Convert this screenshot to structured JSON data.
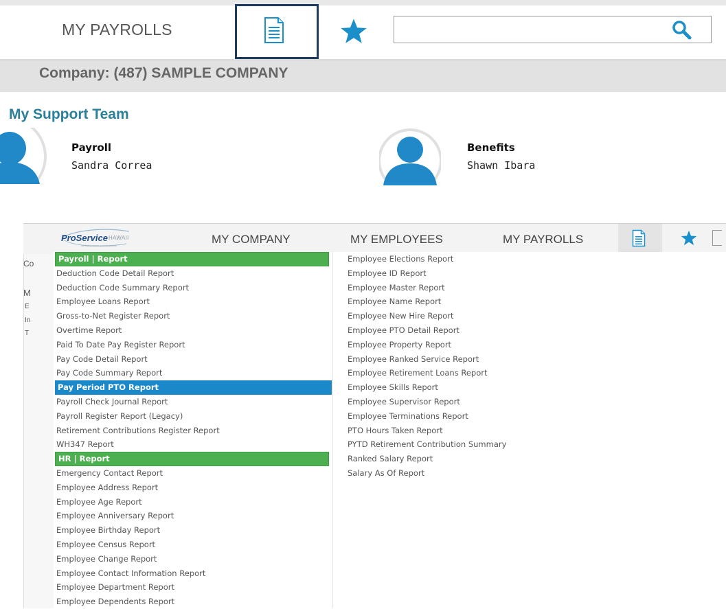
{
  "top": {
    "nav_label": "MY PAYROLLS",
    "search_value": "",
    "company": "Company: (487) SAMPLE COMPANY",
    "support_title": "My Support Team",
    "team": [
      {
        "role": "Payroll",
        "name": "Sandra Correa"
      },
      {
        "role": "Benefits",
        "name": "Shawn Ibara"
      }
    ],
    "icons": {
      "documents": "document-icon",
      "favorites": "star-icon",
      "search": "search-icon"
    },
    "colors": {
      "accent": "#1b8fc9",
      "heading": "#2a7f9a",
      "highlight_border": "#1d3b5f"
    }
  },
  "nav2": {
    "logo_text": "ProService",
    "logo_sub": "HAWAII",
    "logo_tagline": "All that powers your business",
    "items": [
      "MY COMPANY",
      "MY EMPLOYEES",
      "MY PAYROLLS"
    ]
  },
  "left_fragments": [
    "Co",
    "M",
    "E",
    "In",
    "T"
  ],
  "reports": {
    "left": [
      {
        "label": "Payroll | Report",
        "kind": "header"
      },
      {
        "label": "Deduction Code Detail Report"
      },
      {
        "label": "Deduction Code Summary Report"
      },
      {
        "label": "Employee Loans Report"
      },
      {
        "label": "Gross-to-Net Register Report"
      },
      {
        "label": "Overtime Report"
      },
      {
        "label": "Paid To Date Pay Register Report"
      },
      {
        "label": "Pay Code Detail Report"
      },
      {
        "label": "Pay Code Summary Report"
      },
      {
        "label": "Pay Period PTO Report",
        "kind": "selected"
      },
      {
        "label": "Payroll Check Journal Report"
      },
      {
        "label": "Payroll Register Report (Legacy)"
      },
      {
        "label": "Retirement Contributions Register Report"
      },
      {
        "label": "WH347 Report"
      },
      {
        "label": "HR | Report",
        "kind": "header"
      },
      {
        "label": "Emergency Contact Report"
      },
      {
        "label": "Employee Address Report"
      },
      {
        "label": "Employee Age Report"
      },
      {
        "label": "Employee Anniversary Report"
      },
      {
        "label": "Employee Birthday Report"
      },
      {
        "label": "Employee Census Report"
      },
      {
        "label": "Employee Change Report"
      },
      {
        "label": "Employee Contact Information Report"
      },
      {
        "label": "Employee Department Report"
      },
      {
        "label": "Employee Dependents Report"
      }
    ],
    "right": [
      {
        "label": "Employee Elections Report"
      },
      {
        "label": "Employee ID Report"
      },
      {
        "label": "Employee Master Report"
      },
      {
        "label": "Employee Name Report"
      },
      {
        "label": "Employee New Hire Report"
      },
      {
        "label": "Employee PTO Detail Report"
      },
      {
        "label": "Employee Property Report"
      },
      {
        "label": "Employee Ranked Service Report"
      },
      {
        "label": "Employee Retirement Loans Report"
      },
      {
        "label": "Employee Skills Report"
      },
      {
        "label": "Employee Supervisor Report"
      },
      {
        "label": "Employee Terminations Report"
      },
      {
        "label": "PTO Hours Taken Report"
      },
      {
        "label": "PYTD Retirement Contribution Summary"
      },
      {
        "label": "Ranked Salary Report"
      },
      {
        "label": "Salary As Of Report"
      }
    ]
  }
}
